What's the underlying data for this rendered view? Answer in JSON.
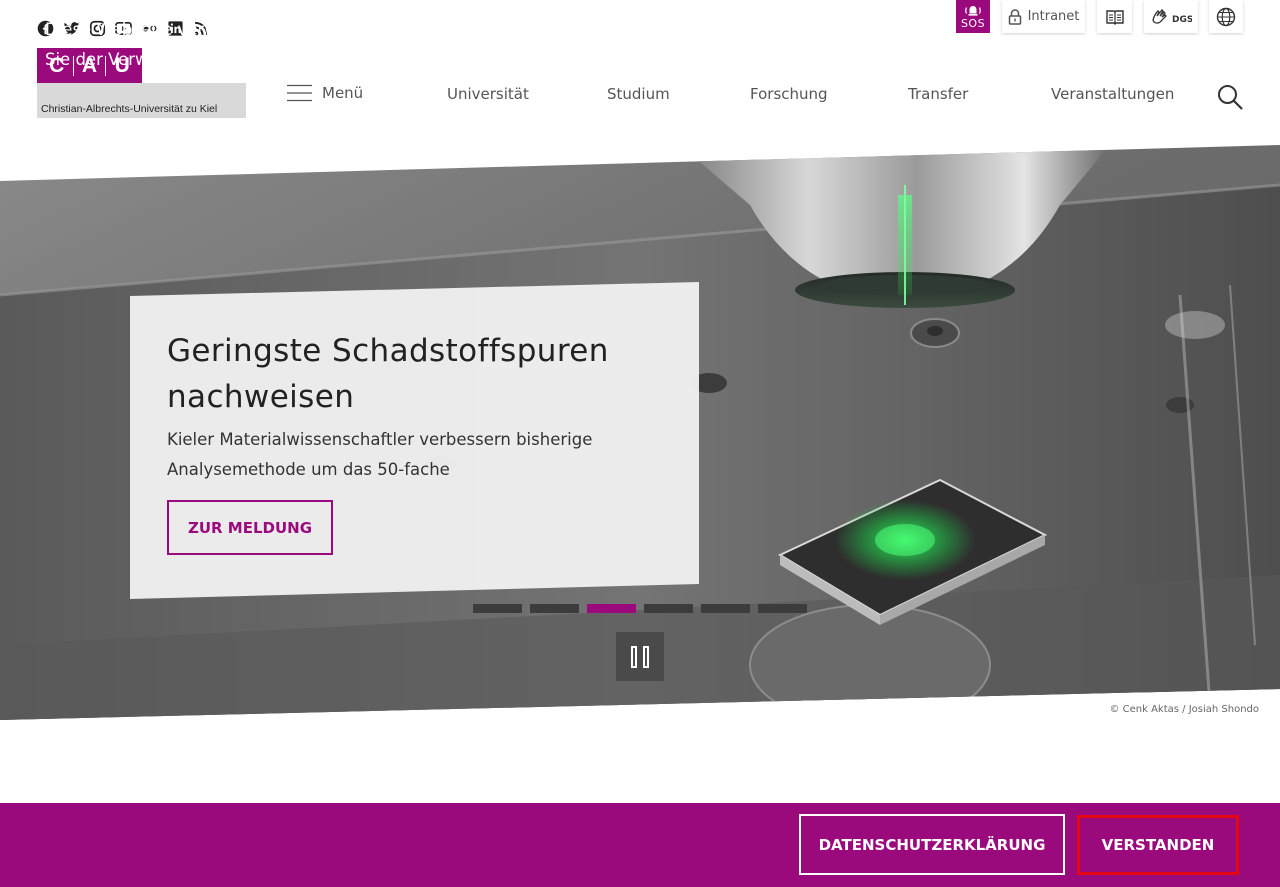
{
  "social": {
    "icons": [
      "facebook-icon",
      "twitter-icon",
      "instagram-icon",
      "youtube-icon",
      "flickr-icon",
      "linkedin-icon",
      "rss-icon"
    ]
  },
  "utility": {
    "sos_label": "SOS",
    "intranet_label": "Intranet"
  },
  "logo": {
    "letters": [
      "C",
      "A",
      "U"
    ],
    "name": "Christian-Albrechts-Universität zu Kiel"
  },
  "nav": {
    "menu_label": "Menü",
    "items": [
      "Universität",
      "Studium",
      "Forschung",
      "Transfer",
      "Veranstaltungen"
    ]
  },
  "hero": {
    "title": "Geringste Schadstoffspuren nachweisen",
    "subtitle": "Kieler Materialwissenschaftler verbessern bisherige Analysemethode um das 50-fache",
    "cta_label": "ZUR MELDUNG",
    "slides_total": 6,
    "active_slide": 3,
    "credit": "© Cenk Aktas / Josiah Shondo"
  },
  "cookie": {
    "text": "Diese Webseite verwendet Cookies. Durch die weitere Nutzung der Webseite stimmen Sie der Verwendung von Cookies zu.",
    "privacy_label": "DATENSCHUTZERKLÄRUNG",
    "accept_label": "VERSTANDEN"
  },
  "colors": {
    "brand": "#9b0a7d",
    "focus_outline": "#e30613",
    "laser_green": "#2bd64a"
  }
}
